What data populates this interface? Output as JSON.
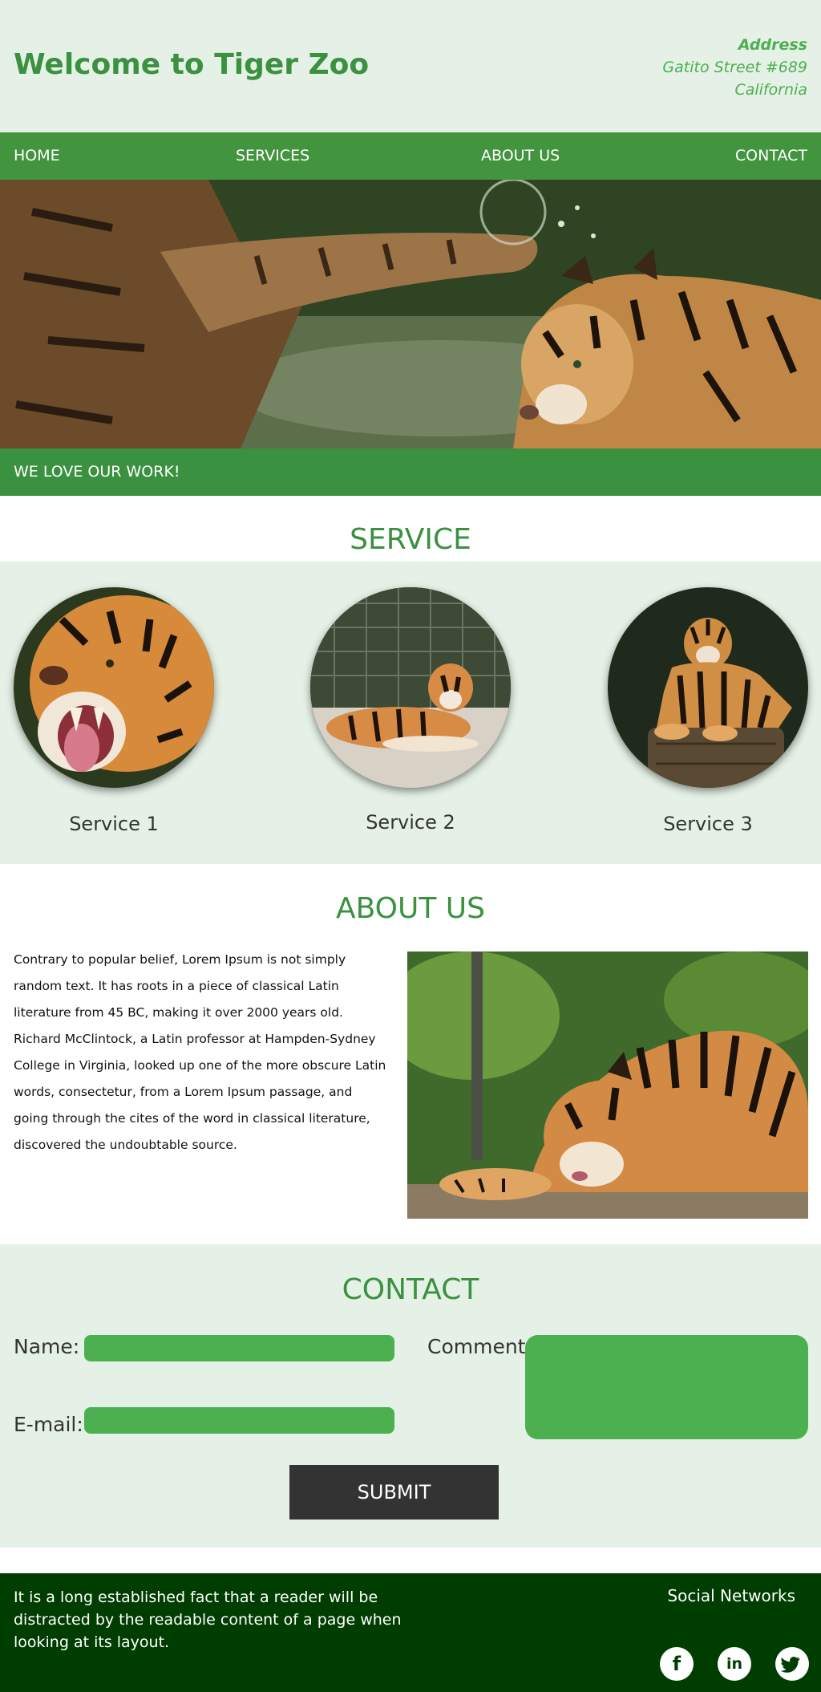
{
  "header": {
    "title": "Welcome to Tiger Zoo",
    "address_label": "Address",
    "address_line1": "Gatito Street #689",
    "address_line2": "California"
  },
  "nav": {
    "items": [
      "HOME",
      "SERVICES",
      "ABOUT US",
      "CONTACT"
    ]
  },
  "hero": {
    "image": "tigers-fighting-in-water"
  },
  "banner": {
    "text": "WE LOVE OUR WORK!"
  },
  "services": {
    "title": "SERVICE",
    "items": [
      {
        "label": "Service 1",
        "image": "tiger-roaring"
      },
      {
        "label": "Service 2",
        "image": "tiger-lying-in-enclosure"
      },
      {
        "label": "Service 3",
        "image": "tiger-on-log"
      }
    ]
  },
  "about": {
    "title": "ABOUT US",
    "text": "Contrary to popular belief, Lorem Ipsum is not simply random text. It has roots in a piece of classical Latin literature from 45 BC, making it over 2000 years old. Richard McClintock, a Latin professor at Hampden-Sydney College in Virginia, looked up one of the more obscure Latin words, consectetur, from a Lorem Ipsum passage, and going through the cites of the word in classical literature, discovered the undoubtable source.",
    "image": "tiger-resting"
  },
  "contact": {
    "title": "CONTACT",
    "name_label": "Name:",
    "email_label": "E-mail:",
    "comment_label": "Comment",
    "submit_label": "SUBMIT"
  },
  "footer": {
    "text": "It is a long established fact that a reader will be distracted by the readable content of a page when looking at its layout.",
    "social_title": "Social Networks",
    "social_icons": [
      "facebook-icon",
      "linkedin-icon",
      "twitter-icon"
    ]
  },
  "colors": {
    "primary_green": "#3a913f",
    "light_green_bg": "#e5f1e6",
    "input_green": "#4caf50",
    "footer_dark": "#003d00",
    "button_dark": "#333333"
  }
}
